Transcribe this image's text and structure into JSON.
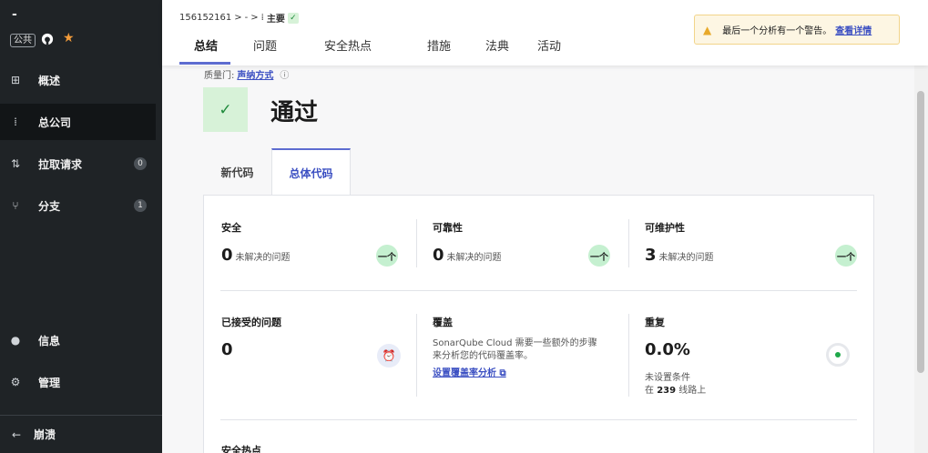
{
  "sidebar": {
    "project_name": "-",
    "public_badge": "公共",
    "items": [
      {
        "label": "概述",
        "icon": "dashboard-icon",
        "glyph": "⊞",
        "count": ""
      },
      {
        "label": "总公司",
        "icon": "branch-main-icon",
        "glyph": "⁞",
        "count": ""
      },
      {
        "label": "拉取请求",
        "icon": "pull-request-icon",
        "glyph": "⇅",
        "count": "0"
      },
      {
        "label": "分支",
        "icon": "branch-icon",
        "glyph": "⑂",
        "count": "1"
      }
    ],
    "bottom_items": [
      {
        "label": "信息",
        "icon": "info-icon",
        "glyph": "●"
      },
      {
        "label": "管理",
        "icon": "gear-icon",
        "glyph": "⚙"
      }
    ],
    "collapse_label": "崩溃",
    "collapse_glyph": "←"
  },
  "header": {
    "breadcrumb": {
      "project_id": "156152161",
      "sep1": ">",
      "dash": "-",
      "sep2": ">",
      "branch": "主要"
    },
    "tabs": [
      "总结",
      "问题",
      "安全热点",
      "措施",
      "法典",
      "活动"
    ],
    "warning": {
      "text": "最后一个分析有一个警告。",
      "link": "查看详情"
    }
  },
  "quality_gate": {
    "label": "质量门:",
    "link": "声纳方式",
    "info_glyph": "ⓘ",
    "status": "通过",
    "status_glyph": "✓"
  },
  "code_tabs": [
    "新代码",
    "总体代码"
  ],
  "metrics": {
    "security": {
      "title": "安全",
      "value": "0",
      "unit": "未解决的问题",
      "rating": "一个"
    },
    "reliability": {
      "title": "可靠性",
      "value": "0",
      "unit": "未解决的问题",
      "rating": "一个"
    },
    "maintainability": {
      "title": "可维护性",
      "value": "3",
      "unit": "未解决的问题",
      "rating": "一个"
    },
    "accepted": {
      "title": "已接受的问题",
      "value": "0"
    },
    "coverage": {
      "title": "覆盖",
      "text": "SonarQube Cloud 需要一些额外的步骤来分析您的代码覆盖率。",
      "link": "设置覆盖率分析 ⧉"
    },
    "duplication": {
      "title": "重复",
      "value": "0.0%",
      "note1": "未设置条件",
      "note2_prefix": "在",
      "note2_num": "239",
      "note2_suffix": "线路上"
    },
    "hotspots": {
      "title": "安全热点"
    }
  },
  "colors": {
    "accent": "#5d6cd0",
    "pass": "#1f8a3b",
    "sidebar": "#1f2326"
  }
}
